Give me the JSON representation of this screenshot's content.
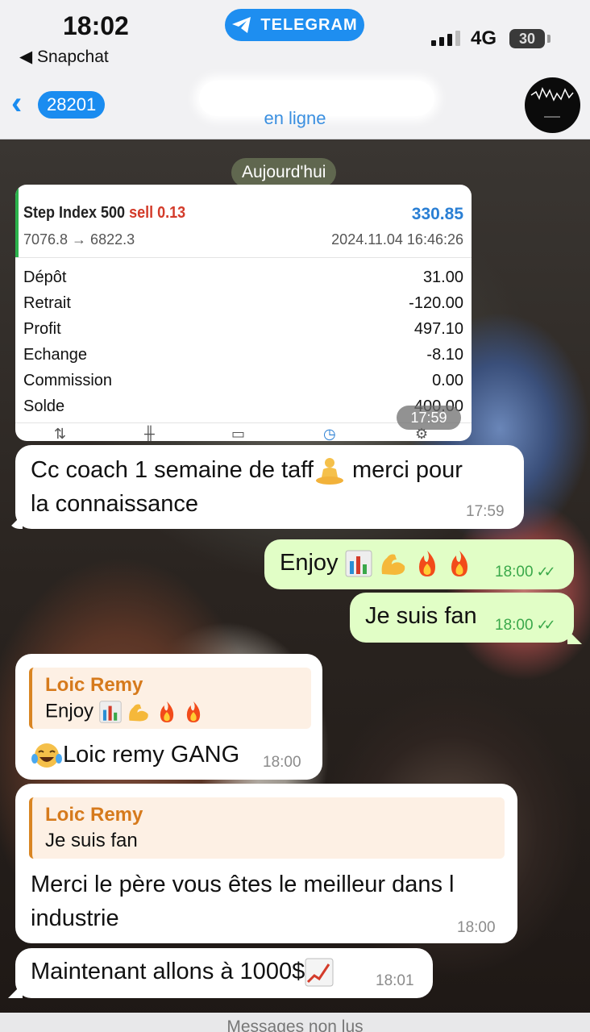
{
  "status_bar": {
    "time": "18:02",
    "back_app": "◀ Snapchat",
    "telegram_pill": "TELEGRAM",
    "network": "4G",
    "battery": "30"
  },
  "header": {
    "back_badge": "28201",
    "subtitle": "en ligne"
  },
  "date_separator": "Aujourd'hui",
  "trade_card": {
    "symbol": "Step Index 500",
    "side": "sell 0.13",
    "profit": "330.85",
    "prices": "7076.8 → 6822.3",
    "datetime": "2024.11.04 16:46:26",
    "rows": [
      {
        "label": "Dépôt",
        "value": "31.00"
      },
      {
        "label": "Retrait",
        "value": "-120.00"
      },
      {
        "label": "Profit",
        "value": "497.10"
      },
      {
        "label": "Echange",
        "value": "-8.10"
      },
      {
        "label": "Commission",
        "value": "0.00"
      },
      {
        "label": "Solde",
        "value": "400.00"
      }
    ],
    "time": "17:59"
  },
  "messages": [
    {
      "text_line1": "Cc coach 1 semaine de taff",
      "text_line1b": " merci pour",
      "text_line2": "la connaissance",
      "time": "17:59"
    },
    {
      "text": "Enjoy",
      "time": "18:00"
    },
    {
      "text": "Je suis fan",
      "time": "18:00"
    },
    {
      "reply_name": "Loic Remy",
      "reply_text": "Enjoy",
      "text": "Loic remy GANG",
      "time": "18:00"
    },
    {
      "reply_name": "Loic Remy",
      "reply_text": "Je suis fan",
      "text_line1": "Merci le père vous êtes le meilleur dans l",
      "text_line2": "industrie",
      "time": "18:00"
    },
    {
      "text": "Maintenant allons à 1000$",
      "time": "18:01"
    }
  ],
  "bottom_bar": "Messages non lus",
  "colors": {
    "telegram_blue": "#1a8cf0",
    "outgoing_bubble": "#e1fec6",
    "reply_accent": "#d67a1c",
    "sell_red": "#d33b2a"
  }
}
